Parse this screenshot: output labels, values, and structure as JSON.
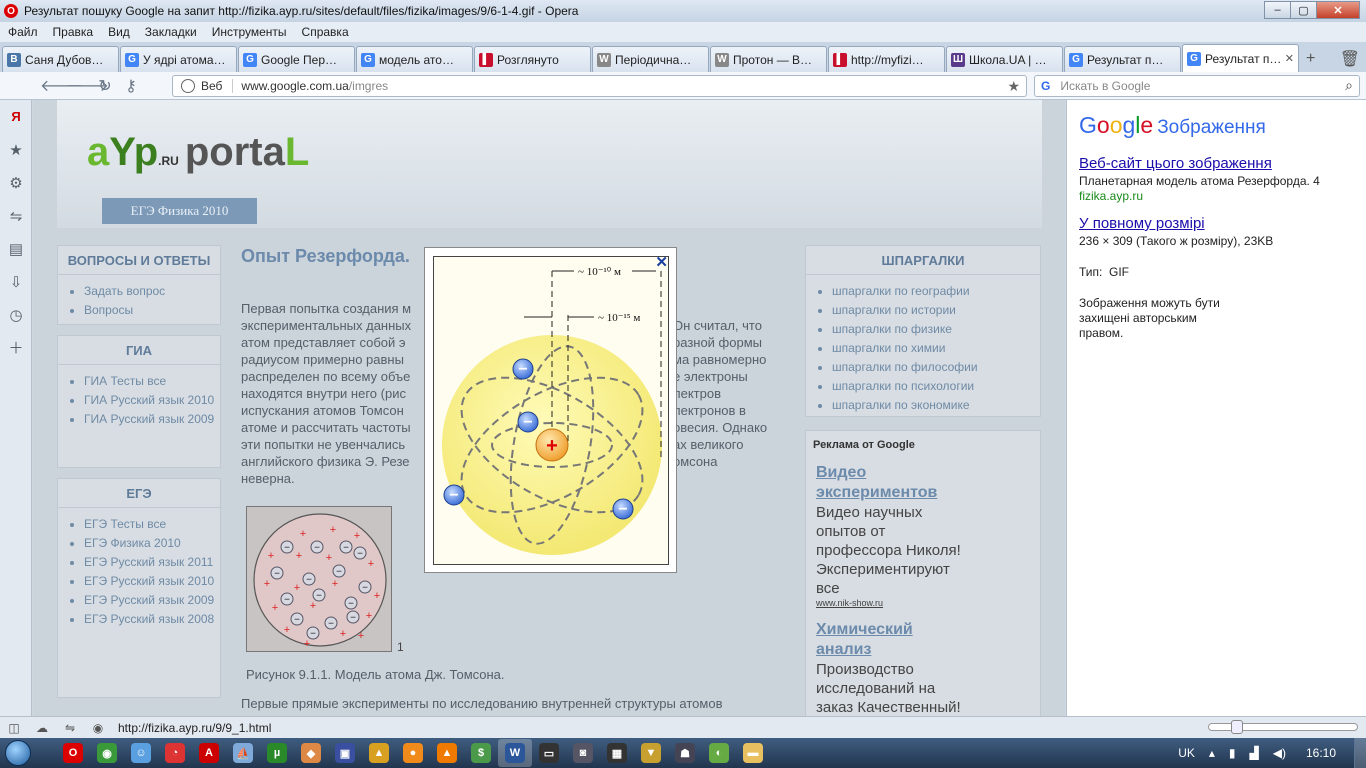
{
  "window": {
    "title": "Результат пошуку Google на запит http://fizika.ayp.ru/sites/default/files/fizika/images/9/6-1-4.gif - Opera",
    "controls": {
      "minimize": "–",
      "maximize": "▢",
      "close": "✕"
    }
  },
  "menu": [
    "Файл",
    "Правка",
    "Вид",
    "Закладки",
    "Инструменты",
    "Справка"
  ],
  "tabs": [
    {
      "label": "Саня Дубов…",
      "icon": "vk-icon",
      "color": "#4a76a8",
      "glyph": "В"
    },
    {
      "label": "У ядрі атома…",
      "icon": "google-images-icon",
      "color": "#4285f4",
      "glyph": "G"
    },
    {
      "label": "Google Пер…",
      "icon": "google-translate-icon",
      "color": "#4285f4",
      "glyph": "G"
    },
    {
      "label": "модель ато…",
      "icon": "google-images-icon",
      "color": "#4285f4",
      "glyph": "G"
    },
    {
      "label": "Розглянуто",
      "icon": "red-page-icon",
      "color": "#c8102e",
      "glyph": "▌"
    },
    {
      "label": "Періодична…",
      "icon": "wikipedia-icon",
      "color": "#888",
      "glyph": "W"
    },
    {
      "label": "Протон — В…",
      "icon": "wikipedia-icon",
      "color": "#888",
      "glyph": "W"
    },
    {
      "label": "http://myfizi…",
      "icon": "red-page-icon",
      "color": "#c8102e",
      "glyph": "▌"
    },
    {
      "label": "Школа.UA | …",
      "icon": "school-icon",
      "color": "#5a3a8a",
      "glyph": "Ш"
    },
    {
      "label": "Результат п…",
      "icon": "google-images-icon",
      "color": "#4285f4",
      "glyph": "G"
    },
    {
      "label": "Результат п…",
      "icon": "google-images-icon",
      "color": "#4285f4",
      "glyph": "G",
      "active": true
    }
  ],
  "address": {
    "mode": "Веб",
    "url_host": "www.google.com.ua",
    "url_path": "/imgres",
    "search_placeholder": "Искать в Google"
  },
  "page": {
    "logo": {
      "a": "a",
      "Y": "Y",
      "p": "p",
      "ru": ".RU",
      "porta": "porta",
      "L": "L"
    },
    "ege_tab": "ЕГЭ Физика 2010",
    "left_boxes": [
      {
        "title": "ВОПРОСЫ И ОТВЕТЫ",
        "items": [
          "Задать вопрос",
          "Вопросы"
        ]
      },
      {
        "title": "ГИА",
        "items": [
          "ГИА Тесты все",
          "ГИА Русский язык 2010",
          "ГИА Русский язык 2009"
        ]
      },
      {
        "title": "ЕГЭ",
        "items": [
          "ЕГЭ Тесты все",
          "ЕГЭ Физика 2010",
          "ЕГЭ Русский язык 2011",
          "ЕГЭ Русский язык 2010",
          "ЕГЭ Русский язык 2009",
          "ЕГЭ Русский язык 2008"
        ]
      }
    ],
    "article_title": "Опыт Резерфорда.",
    "para_left": [
      "Первая попытка создания м",
      "экспериментальных данных",
      "атом представляет собой э",
      "радиусом примерно равны",
      "распределен по всему объе",
      "находятся внутри него (рис",
      "испускания атомов Томсон",
      "атоме и рассчитать частоты",
      "эти попытки не увенчались",
      "английского физика Э. Резе",
      "неверна."
    ],
    "para_right": [
      "Он считал, что",
      "разной формы",
      "ма равномерно",
      "е электроны",
      "лектров",
      "лектронов в",
      "овесия. Однако",
      "ах великого",
      "омсона"
    ],
    "figure_number": "1",
    "figure_caption": "Рисунок 9.1.1. Модель атома Дж. Томсона.",
    "bottom_text": "Первые прямые эксперименты по исследованию внутренней структуры атомов",
    "right_box": {
      "title": "ШПАРГАЛКИ",
      "items": [
        "шпаргалки по географии",
        "шпаргалки по истории",
        "шпаргалки по физике",
        "шпаргалки по химии",
        "шпаргалки по философии",
        "шпаргалки по психологии",
        "шпаргалки по экономике"
      ]
    },
    "ads": {
      "header": "Реклама от Google",
      "items": [
        {
          "title_lines": [
            "Видео",
            "экспериментов"
          ],
          "body_lines": [
            "Видео научных",
            "опытов от",
            "профессора Николя!",
            "Экспериментируют",
            "все"
          ],
          "url": "www.nik-show.ru"
        },
        {
          "title_lines": [
            "Химический",
            "анализ"
          ],
          "body_lines": [
            "Производство",
            "исследований на",
            "заказ Качественный!"
          ],
          "url": ""
        }
      ]
    }
  },
  "lightbox": {
    "close": "✕",
    "label_atom": "~ 10⁻¹⁰ м",
    "label_nucleus": "~ 10⁻¹⁵ м",
    "nucleus_sign": "+",
    "electron_sign": "−"
  },
  "info_panel": {
    "brand": [
      "G",
      "o",
      "o",
      "g",
      "l",
      "e"
    ],
    "section": "Зображення",
    "site_link": "Веб-сайт цього зображення",
    "site_title": "Планетарная модель атома Резерфорда. 4",
    "site_domain": "fizika.ayp.ru",
    "full_link": "У повному розмірі",
    "full_info": "236 × 309 (Такого ж розміру), 23KB",
    "type": "Тип:  GIF",
    "copyright": "Зображення можуть бути захищені авторським правом."
  },
  "status": {
    "url": "http://fizika.ayp.ru/9/9_1.html"
  },
  "taskbar": {
    "apps": [
      {
        "name": "opera-icon",
        "color": "#d00",
        "glyph": "O"
      },
      {
        "name": "chrome-icon",
        "color": "#3a9a3a",
        "glyph": "◉"
      },
      {
        "name": "finder-icon",
        "color": "#5aa0e0",
        "glyph": "☺"
      },
      {
        "name": "media-icon",
        "color": "#d33",
        "glyph": "◔"
      },
      {
        "name": "pdf-icon",
        "color": "#c00",
        "glyph": "A"
      },
      {
        "name": "ship-icon",
        "color": "#7fa9d9",
        "glyph": "⛵"
      },
      {
        "name": "utorrent-icon",
        "color": "#2a8a2a",
        "glyph": "µ"
      },
      {
        "name": "game-icon",
        "color": "#d84",
        "glyph": "◆"
      },
      {
        "name": "save-icon",
        "color": "#3a4fa0",
        "glyph": "▣"
      },
      {
        "name": "warning-icon",
        "color": "#d8a020",
        "glyph": "▲"
      },
      {
        "name": "orange-icon",
        "color": "#f08a1a",
        "glyph": "●"
      },
      {
        "name": "vlc-icon",
        "color": "#f07a00",
        "glyph": "▲"
      },
      {
        "name": "money-icon",
        "color": "#4a9a4a",
        "glyph": "$"
      },
      {
        "name": "word-icon",
        "color": "#2b579a",
        "glyph": "W",
        "active": true
      },
      {
        "name": "screen-icon",
        "color": "#333",
        "glyph": "▭"
      },
      {
        "name": "tank-icon",
        "color": "#556",
        "glyph": "◙"
      },
      {
        "name": "nvidia-icon",
        "color": "#333",
        "glyph": "▦"
      },
      {
        "name": "vector-icon",
        "color": "#c8a030",
        "glyph": "▼"
      },
      {
        "name": "cat-icon",
        "color": "#445",
        "glyph": "☗"
      },
      {
        "name": "sound-app-icon",
        "color": "#6a4",
        "glyph": "◐"
      },
      {
        "name": "folder-icon",
        "color": "#e8c060",
        "glyph": "▬"
      }
    ],
    "lang": "UK",
    "time": "16:10"
  }
}
